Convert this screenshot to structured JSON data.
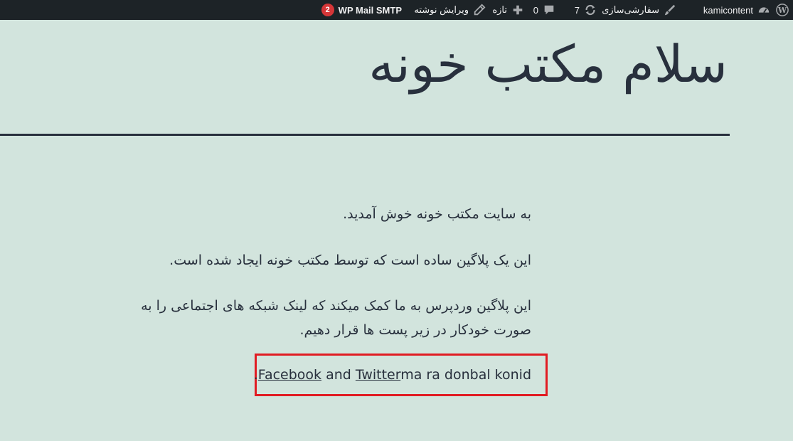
{
  "admin_bar": {
    "site_name": "kamicontent",
    "customize_label": "سفارشی‌سازی",
    "updates_count": "7",
    "comments_count": "0",
    "new_label": "تازه",
    "edit_post_label": "ویرایش نوشته",
    "smtp_label": "WP Mail SMTP",
    "smtp_badge": "2",
    "background_color": "#1d2327",
    "badge_color": "#d63638"
  },
  "site": {
    "title": "سلام مکتب خونه",
    "background_color": "#d2e4dd",
    "text_color": "#28303d"
  },
  "content": {
    "paragraph_1": "به سایت مکتب خونه خوش آمدید.",
    "paragraph_2": "این یک پلاگین ساده است که توسط مکتب خونه ایجاد شده است.",
    "paragraph_3": "این پلاگین وردپرس به ما کمک میکند که لینک شبکه های اجتماعی را به صورت خودکار در زیر پست ها قرار دهیم.",
    "social": {
      "facebook_link": "Facebook",
      "and_text": " and ",
      "twitter_link": "Twitter",
      "trailing_text": "ma ra donbal konid."
    },
    "highlight_color": "#e11b22"
  }
}
